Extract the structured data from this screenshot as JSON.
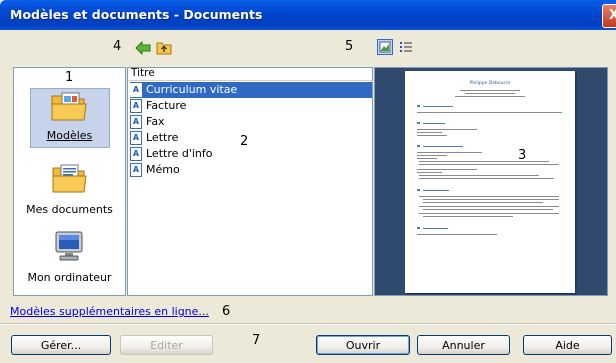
{
  "window": {
    "title": "Modèles et documents - Documents",
    "close": "X"
  },
  "markers": {
    "n1": "1",
    "n2": "2",
    "n3": "3",
    "n4": "4",
    "n5": "5",
    "n6": "6",
    "n7": "7"
  },
  "toolbar": {
    "back_icon": "back-arrow-icon",
    "up_icon": "folder-up-icon",
    "preview_icon": "preview-icon",
    "details_icon": "document-properties-icon"
  },
  "locations": [
    {
      "label": "Modèles",
      "underline": "M",
      "icon": "templates-folder-icon",
      "selected": true
    },
    {
      "label": "Mes documents",
      "underline": "d",
      "icon": "documents-folder-icon",
      "selected": false
    },
    {
      "label": "Mon ordinateur",
      "underline": "o",
      "icon": "computer-icon",
      "selected": false
    }
  ],
  "list": {
    "header": "Titre",
    "items": [
      "Curriculum vitae",
      "Facture",
      "Fax",
      "Lettre",
      "Lettre d'info",
      "Mémo"
    ],
    "selected_index": 0
  },
  "preview": {
    "page_title": "Philippe Deboucre"
  },
  "link": {
    "label": "Modèles supplémentaires en ligne..."
  },
  "buttons": {
    "manage": "Gérer...",
    "edit": "Editer",
    "open": "Ouvrir",
    "cancel": "Annuler",
    "help": "Aide"
  },
  "colors": {
    "titlebar": "#0047d0",
    "selection": "#316ac5",
    "preview_bg": "#2f4a6e",
    "link": "#0000ee"
  }
}
